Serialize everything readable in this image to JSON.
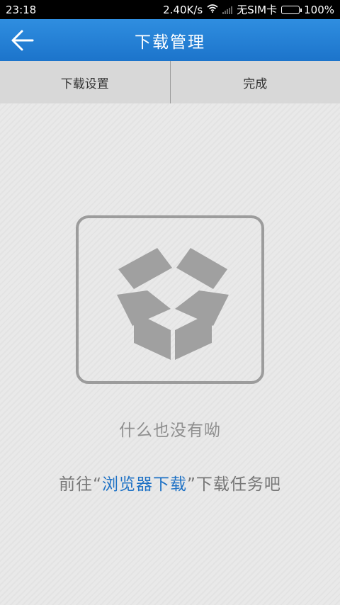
{
  "status": {
    "time": "23:18",
    "speed": "2.40K/s",
    "sim": "无SIM卡",
    "battery": "100%"
  },
  "header": {
    "title": "下载管理",
    "back_icon": "arrow-left-icon"
  },
  "actions": {
    "settings_label": "下载设置",
    "done_label": "完成"
  },
  "empty": {
    "icon": "open-box-icon",
    "message": "什么也没有呦",
    "hint_prefix": "前往“",
    "hint_link": "浏览器下载",
    "hint_suffix": "”下载任务吧"
  },
  "colors": {
    "accent": "#1f72c5",
    "header": "#2a86da",
    "battery": "#3fd54c"
  }
}
